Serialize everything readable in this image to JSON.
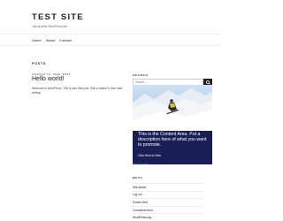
{
  "site": {
    "title": "TEST SITE",
    "tagline": "Just another WordPress site"
  },
  "nav": {
    "items": [
      "Home",
      "About",
      "Contact"
    ]
  },
  "main": {
    "section_title": "POSTS",
    "post": {
      "date": "AUGUST 12, 2020",
      "edit": "EDIT",
      "title": "Hello world!",
      "excerpt": "Welcome to WordPress. This is your first post. Edit or delete it, then start writing!"
    }
  },
  "sidebar": {
    "search": {
      "label": "SEARCH",
      "placeholder": "Search ..."
    },
    "promo": {
      "text": "This is the Content Area. Put a description here of what you want to promote.",
      "button": "Click Here to View"
    },
    "recent_text": "Recent posts",
    "meta": {
      "title": "META",
      "items": [
        "Site Admin",
        "Log out",
        "Entries feed",
        "Comments feed",
        "WordPress.org"
      ]
    }
  }
}
